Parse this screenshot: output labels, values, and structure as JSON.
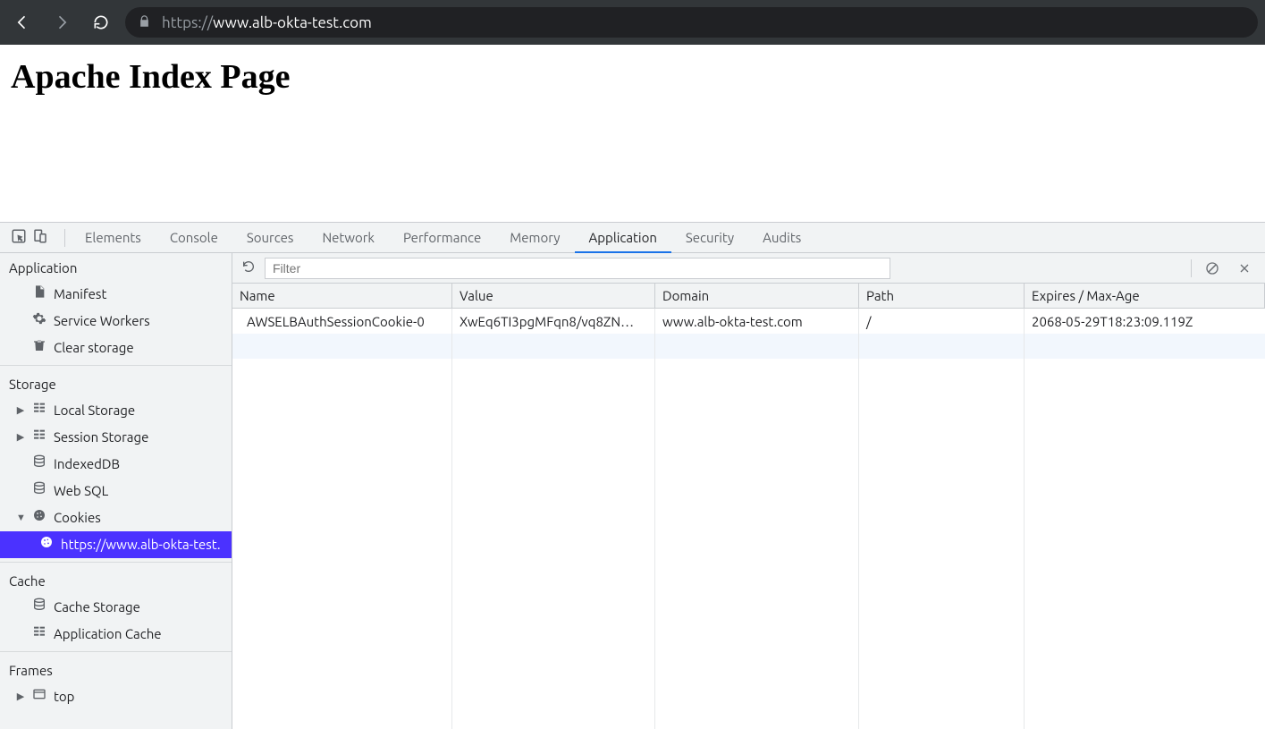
{
  "browser": {
    "url_prefix": "https://",
    "url_host": "www.alb-okta-test.com",
    "url_suffix": ""
  },
  "page": {
    "heading": "Apache Index Page"
  },
  "devtools": {
    "tabs": [
      "Elements",
      "Console",
      "Sources",
      "Network",
      "Performance",
      "Memory",
      "Application",
      "Security",
      "Audits"
    ],
    "selected_tab": "Application",
    "filter_placeholder": "Filter",
    "sidebar": {
      "groups": [
        {
          "title": "Application",
          "items": [
            {
              "label": "Manifest",
              "icon": "doc"
            },
            {
              "label": "Service Workers",
              "icon": "gear"
            },
            {
              "label": "Clear storage",
              "icon": "trash"
            }
          ]
        },
        {
          "title": "Storage",
          "items": [
            {
              "label": "Local Storage",
              "icon": "grid",
              "expandable": true,
              "expanded": false
            },
            {
              "label": "Session Storage",
              "icon": "grid",
              "expandable": true,
              "expanded": false
            },
            {
              "label": "IndexedDB",
              "icon": "db"
            },
            {
              "label": "Web SQL",
              "icon": "db"
            },
            {
              "label": "Cookies",
              "icon": "cookie",
              "expandable": true,
              "expanded": true,
              "children": [
                {
                  "label": "https://www.alb-okta-test.",
                  "icon": "cookie",
                  "selected": true
                }
              ]
            }
          ]
        },
        {
          "title": "Cache",
          "items": [
            {
              "label": "Cache Storage",
              "icon": "db"
            },
            {
              "label": "Application Cache",
              "icon": "grid"
            }
          ]
        },
        {
          "title": "Frames",
          "items": [
            {
              "label": "top",
              "icon": "frame",
              "expandable": true,
              "expanded": false
            }
          ]
        }
      ]
    },
    "cookie_table": {
      "columns": [
        "Name",
        "Value",
        "Domain",
        "Path",
        "Expires / Max-Age"
      ],
      "rows": [
        {
          "name": "AWSELBAuthSessionCookie-0",
          "value": "XwEq6TI3pgMFqn8/vq8ZN…",
          "domain": "www.alb-okta-test.com",
          "path": "/",
          "expires": "2068-05-29T18:23:09.119Z"
        }
      ]
    }
  }
}
